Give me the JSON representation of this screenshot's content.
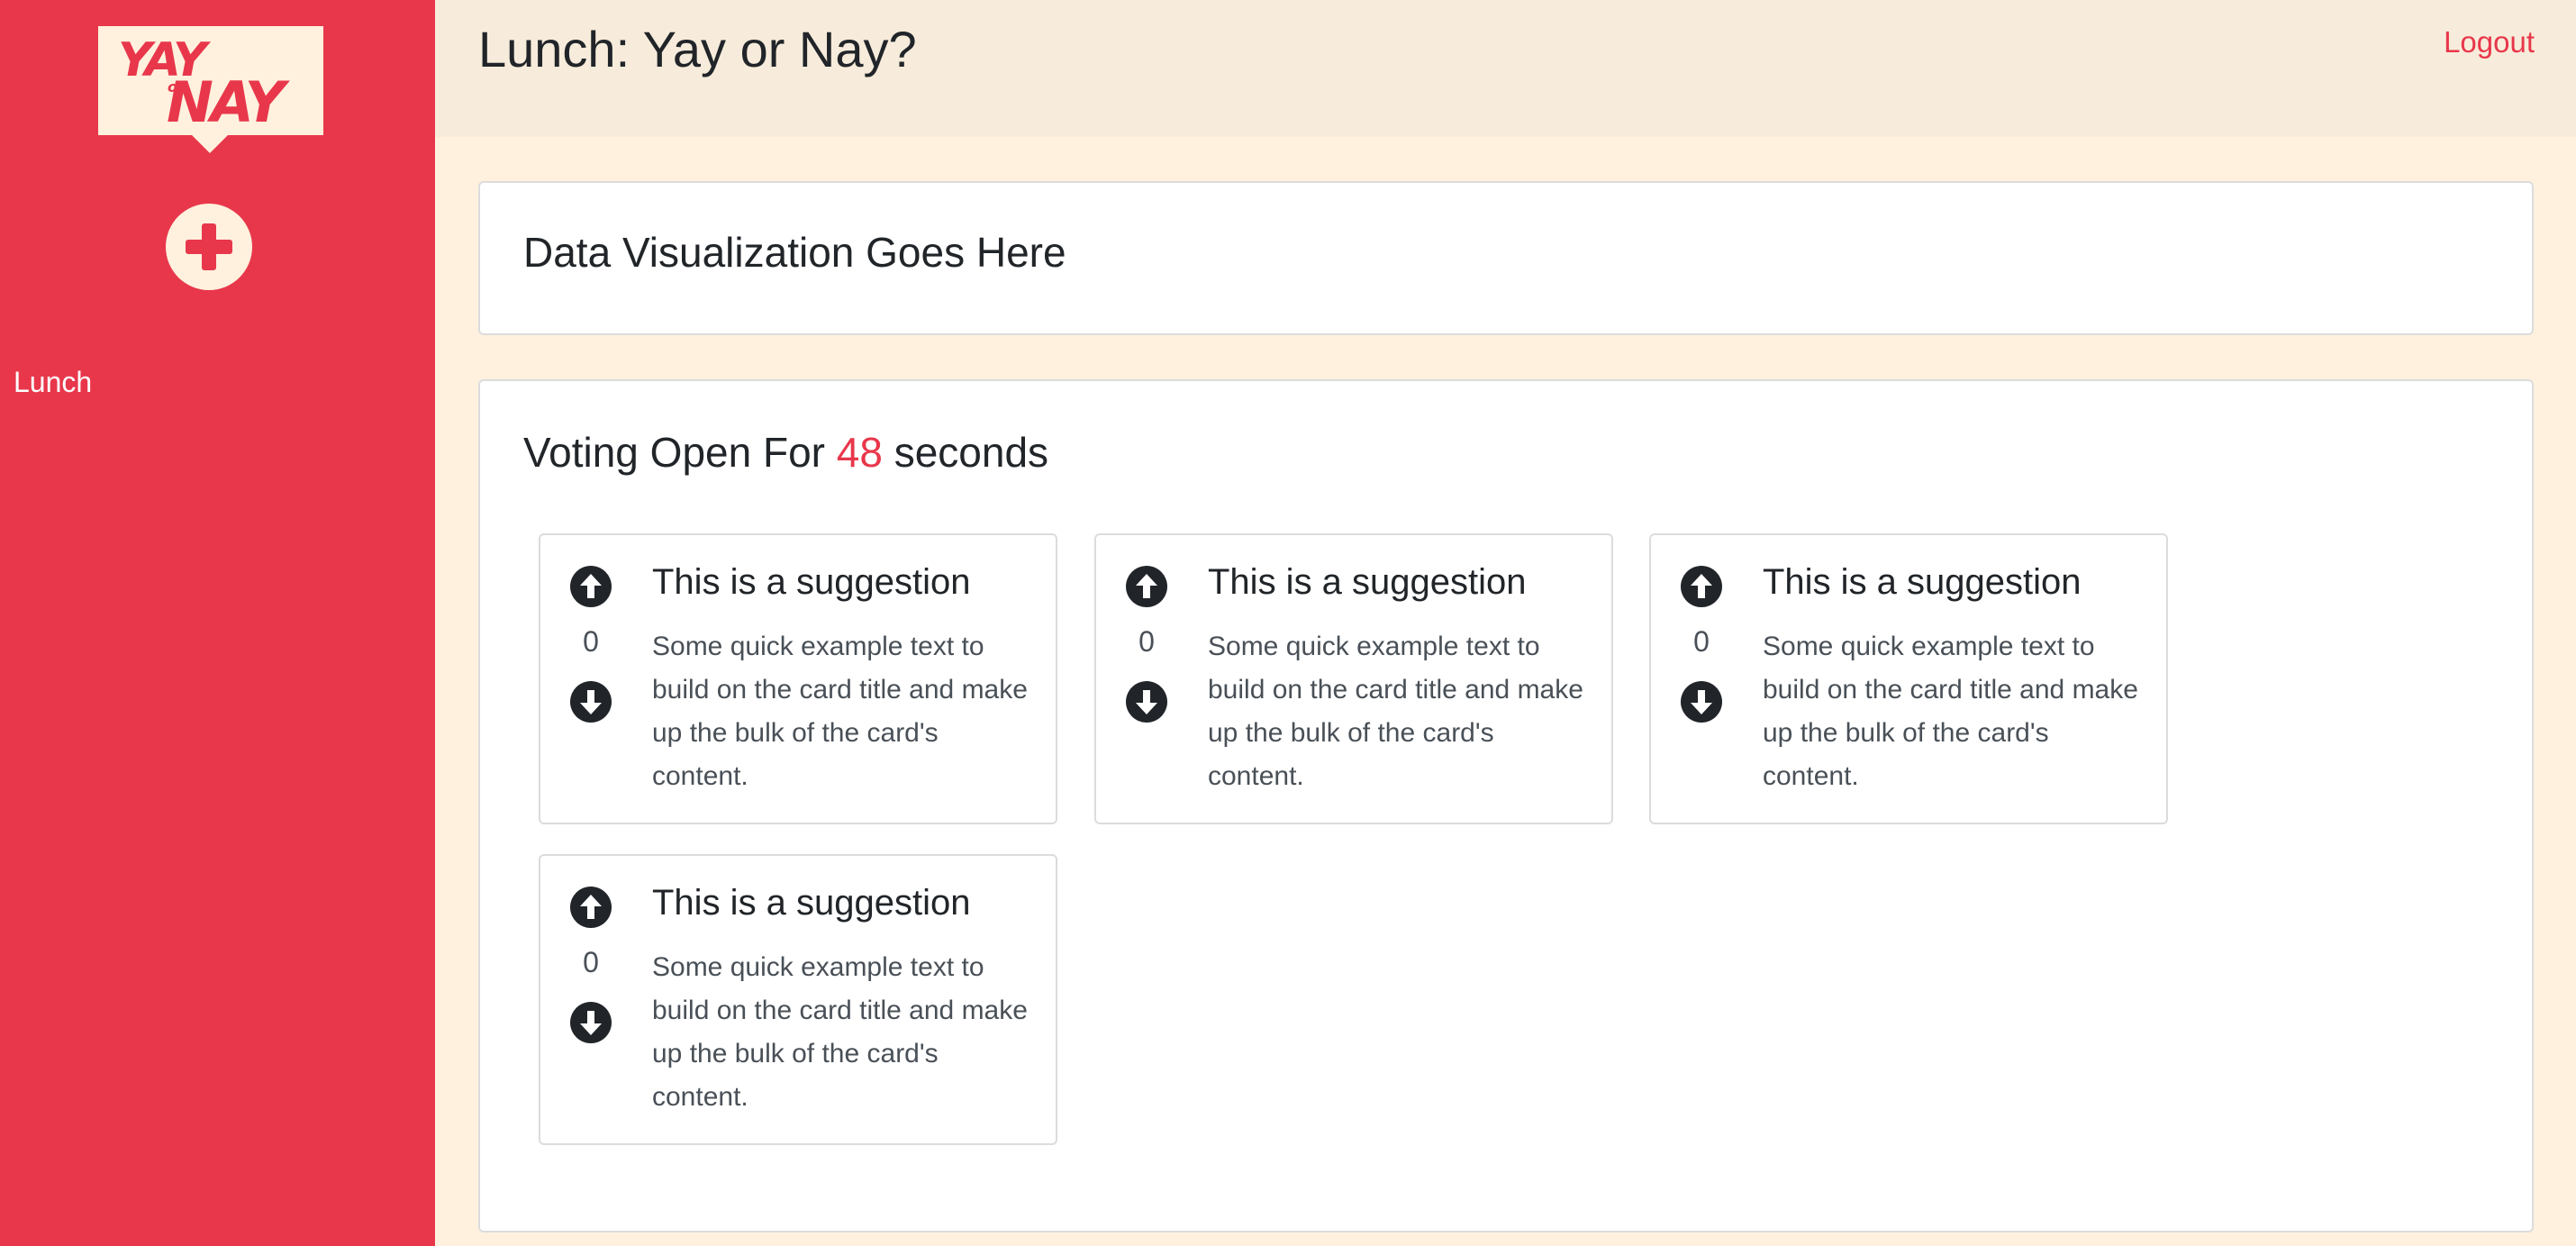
{
  "brand": {
    "logo_top": "YAY",
    "logo_mid": "or",
    "logo_bottom": "NAY"
  },
  "sidebar": {
    "add_label": "Add",
    "links": [
      {
        "label": "Lunch"
      }
    ]
  },
  "header": {
    "title": "Lunch: Yay or Nay?",
    "logout_label": "Logout"
  },
  "visualization": {
    "heading": "Data Visualization Goes Here"
  },
  "voting": {
    "prefix": "Voting Open For",
    "seconds": "48",
    "suffix": "seconds",
    "cards": [
      {
        "title": "This is a suggestion",
        "text": "Some quick example text to build on the card title and make up the bulk of the card's content.",
        "votes": "0"
      },
      {
        "title": "This is a suggestion",
        "text": "Some quick example text to build on the card title and make up the bulk of the card's content.",
        "votes": "0"
      },
      {
        "title": "This is a suggestion",
        "text": "Some quick example text to build on the card title and make up the bulk of the card's content.",
        "votes": "0"
      },
      {
        "title": "This is a suggestion",
        "text": "Some quick example text to build on the card title and make up the bulk of the card's content.",
        "votes": "0"
      }
    ]
  },
  "icons": {
    "add": "plus-circle-icon",
    "upvote": "arrow-up-circle-icon",
    "downvote": "arrow-down-circle-icon"
  },
  "colors": {
    "accent": "#e8374b",
    "cream": "#fff1de",
    "header_bg": "#f7ecdb",
    "dark": "#212529"
  }
}
